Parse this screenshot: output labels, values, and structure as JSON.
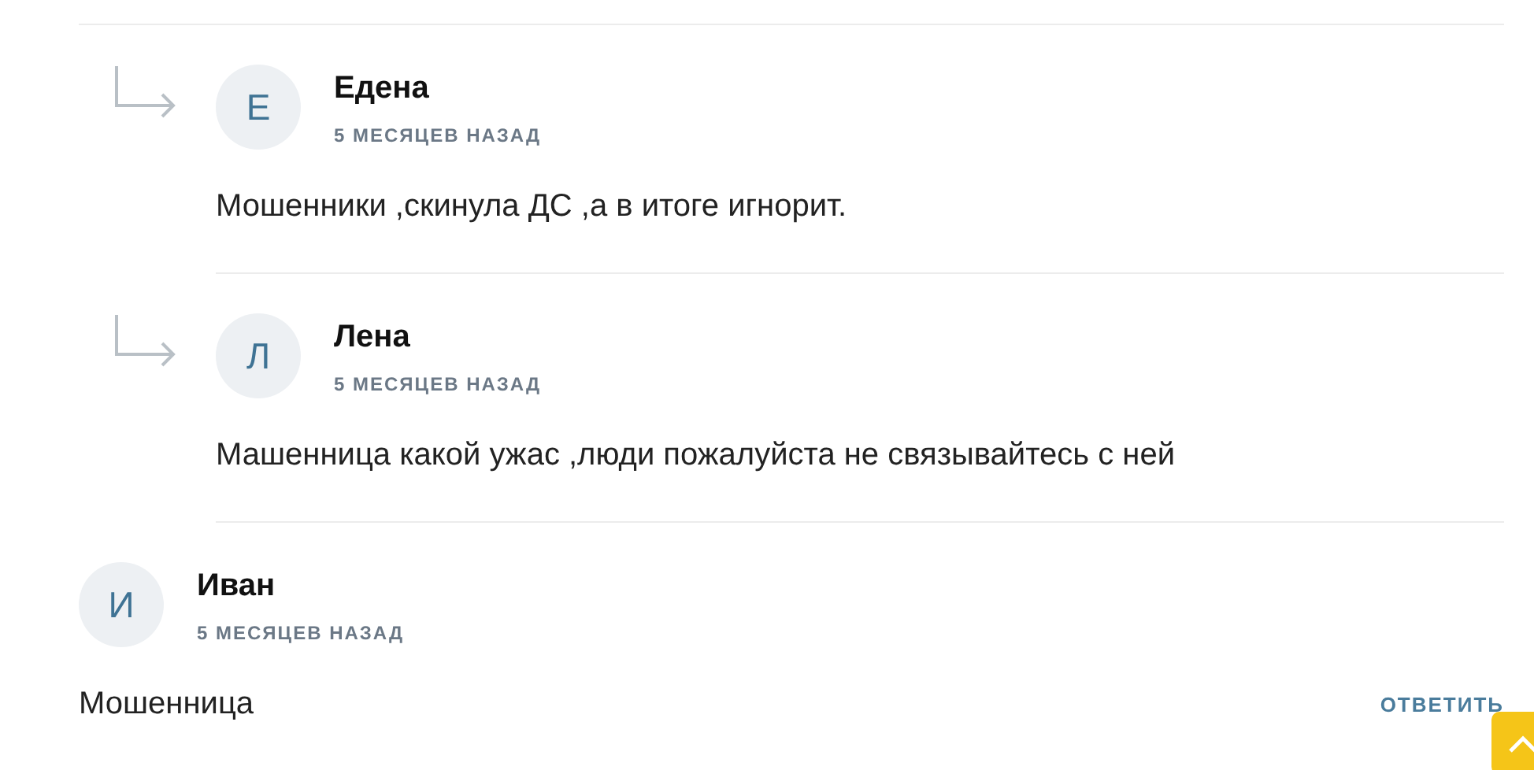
{
  "comments": [
    {
      "kind": "reply",
      "initial": "Е",
      "author": "Едена",
      "date": "5 МЕСЯЦЕВ НАЗАД",
      "text": "Мошенники ,скинула ДС ,а в итоге игнорит."
    },
    {
      "kind": "reply",
      "initial": "Л",
      "author": "Лена",
      "date": "5 МЕСЯЦЕВ НАЗАД",
      "text": "Машенница какой ужас ,люди пожалуйста не связывайтесь с ней"
    },
    {
      "kind": "top",
      "initial": "И",
      "author": "Иван",
      "date": "5 МЕСЯЦЕВ НАЗАД",
      "text": "Мошенница",
      "reply_label": "ОТВЕТИТЬ"
    }
  ]
}
